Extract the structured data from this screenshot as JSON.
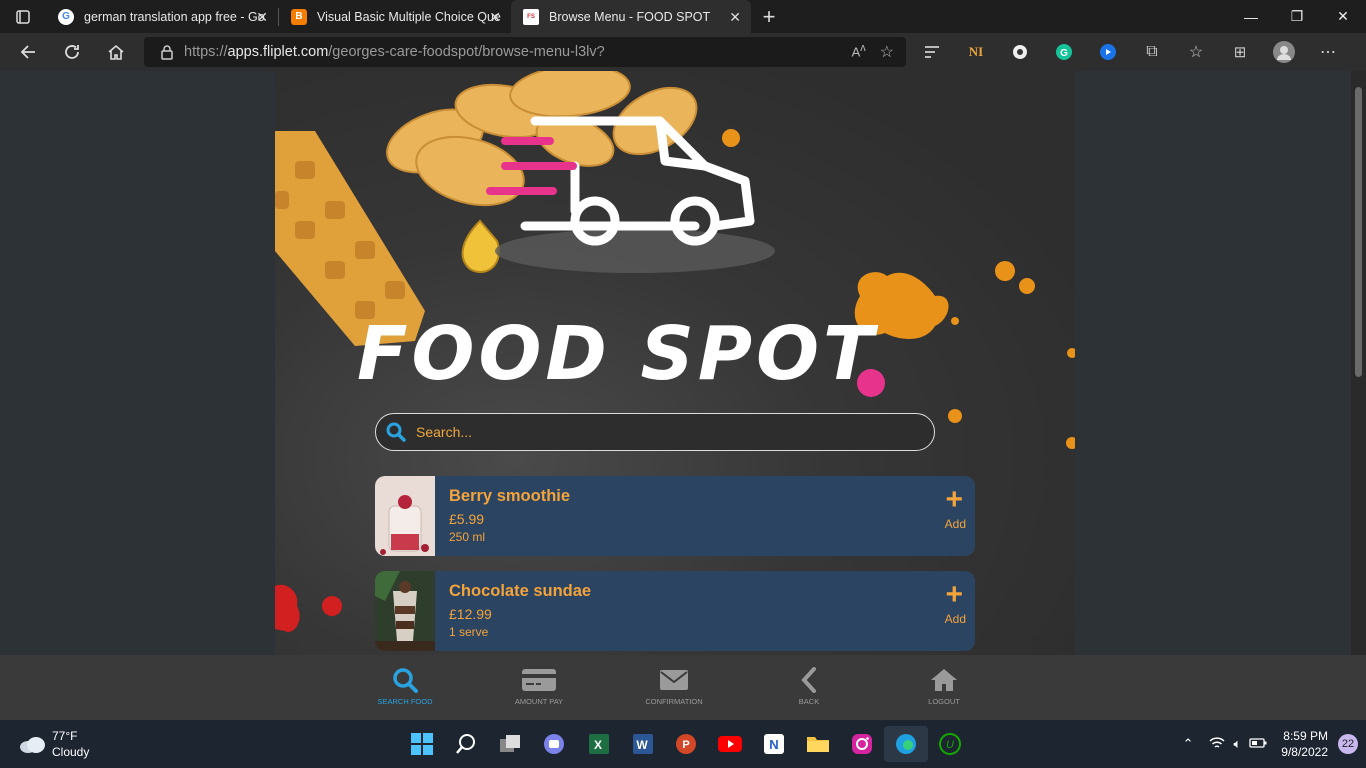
{
  "browser": {
    "tabs": [
      {
        "title": "german translation app free - Go",
        "favicon": "google-icon",
        "active": false
      },
      {
        "title": "Visual Basic Multiple Choice Que",
        "favicon": "blogger-icon",
        "active": false
      },
      {
        "title": "Browse Menu - FOOD SPOT",
        "favicon": "foodspot-icon",
        "active": true
      }
    ],
    "url_prefix": "https://",
    "url_host": "apps.fliplet.com",
    "url_path": "/georges-care-foodspot/browse-menu-l3lv?"
  },
  "app": {
    "title": "FOOD SPOT",
    "search": {
      "placeholder": "Search..."
    },
    "items": [
      {
        "name": "Berry smoothie",
        "price": "£5.99",
        "size": "250 ml",
        "action": "Add"
      },
      {
        "name": "Chocolate sundae",
        "price": "£12.99",
        "size": "1 serve",
        "action": "Add"
      }
    ],
    "nav": [
      {
        "label": "SEARCH FOOD",
        "icon": "search-icon",
        "active": true
      },
      {
        "label": "AMOUNT PAY",
        "icon": "credit-card-icon",
        "active": false
      },
      {
        "label": "CONFIRMATION",
        "icon": "envelope-icon",
        "active": false
      },
      {
        "label": "BACK",
        "icon": "chevron-left-icon",
        "active": false
      },
      {
        "label": "LOGOUT",
        "icon": "home-icon",
        "active": false
      }
    ],
    "colors": {
      "accent": "#f2a33c",
      "card": "#2b4461",
      "nav_active": "#29a3e0",
      "pink": "#e7338b"
    }
  },
  "taskbar": {
    "weather_temp": "77°F",
    "weather_desc": "Cloudy",
    "time": "8:59 PM",
    "date": "9/8/2022",
    "notifications": "22"
  }
}
